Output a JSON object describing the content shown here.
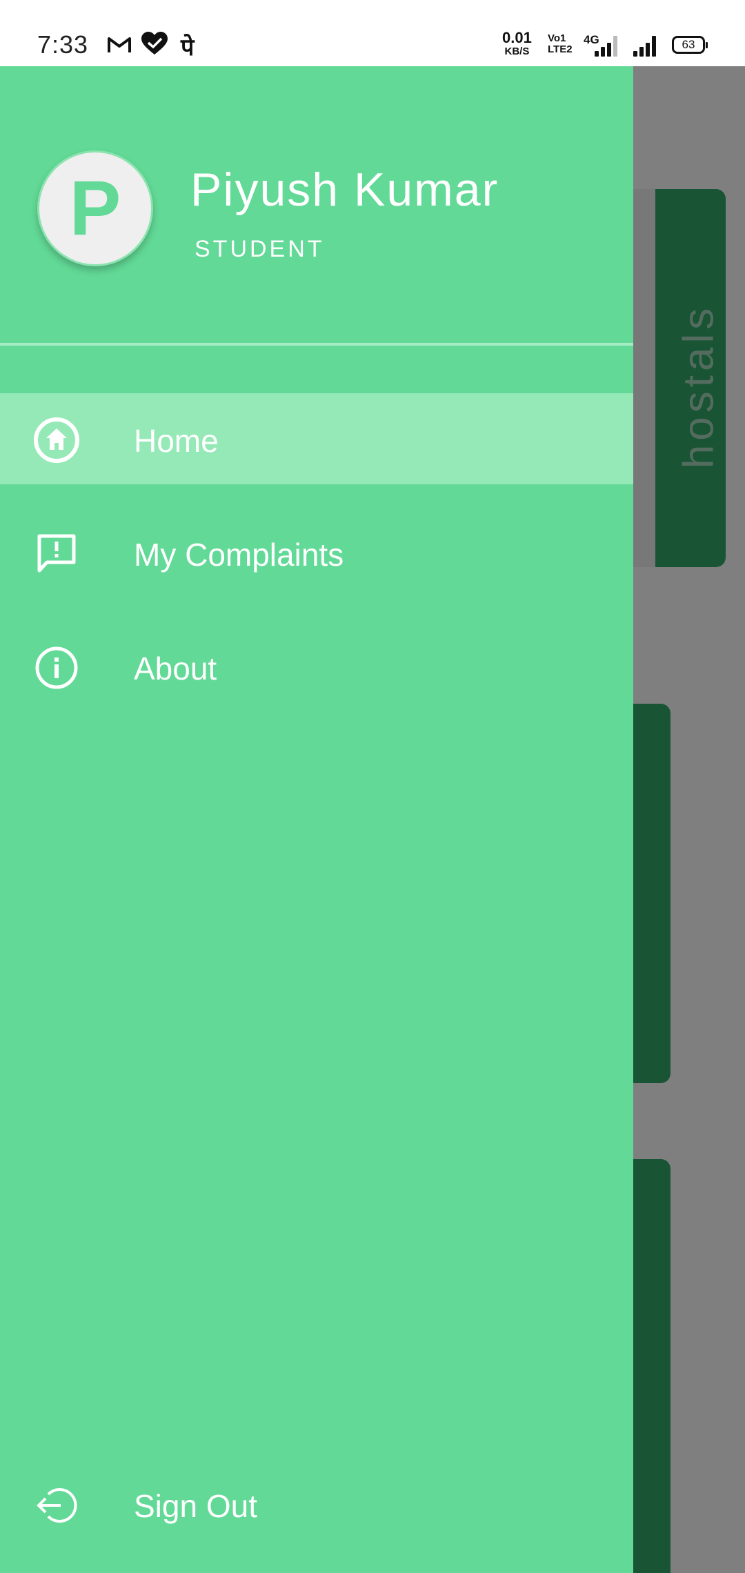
{
  "status_bar": {
    "time": "7:33",
    "notifications": [
      "gmail-icon",
      "heart-check-icon",
      "पे"
    ],
    "net_speed_value": "0.01",
    "net_speed_unit": "KB/S",
    "volte_top": "Vo1",
    "volte_bottom": "LTE2",
    "network_type": "4G",
    "battery": "63"
  },
  "drawer": {
    "avatar_letter": "P",
    "user_name": "Piyush Kumar",
    "user_role": "STUDENT",
    "menu": [
      {
        "label": "Home",
        "icon": "home-icon",
        "selected": true
      },
      {
        "label": "My Complaints",
        "icon": "feedback-icon",
        "selected": false
      },
      {
        "label": "About",
        "icon": "info-icon",
        "selected": false
      }
    ],
    "sign_out": {
      "label": "Sign Out",
      "icon": "sign-out-icon"
    }
  },
  "background_screen": {
    "hostels_label": "hostals"
  },
  "colors": {
    "drawer": "#62d996",
    "selected_item": "#95e9b7",
    "card_green": "#33a868"
  }
}
